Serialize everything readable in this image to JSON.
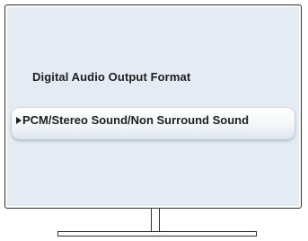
{
  "menu": {
    "title": "Digital Audio Output Format",
    "selected_option": "PCM/Stereo Sound/Non Surround Sound",
    "indicator_icon": "right-triangle-icon"
  },
  "colors": {
    "screen_background": "#e4ebf2",
    "text": "#1e1e1e",
    "frame": "#2d2d2d"
  }
}
